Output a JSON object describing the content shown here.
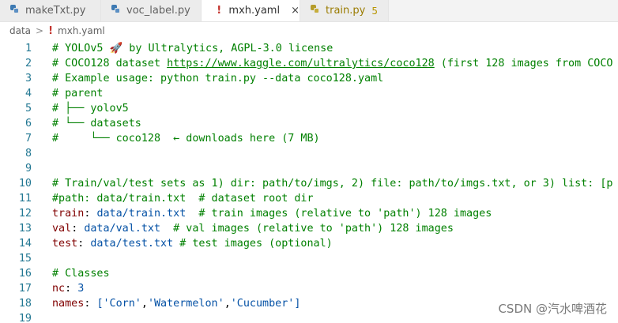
{
  "tabs": [
    {
      "label": "makeTxt.py",
      "icon": "python-file-icon"
    },
    {
      "label": "voc_label.py",
      "icon": "python-file-icon"
    },
    {
      "label": "mxh.yaml",
      "icon": "yaml-file-icon",
      "close": "×"
    },
    {
      "label": "train.py",
      "icon": "python-file-icon",
      "problems": "5"
    }
  ],
  "breadcrumb": {
    "folder": "data",
    "separator": ">",
    "file": "mxh.yaml",
    "yaml_glyph": "!"
  },
  "lines": [
    {
      "n": "1",
      "parts": [
        {
          "t": "# YOLOv5 🚀 by Ultralytics, AGPL-3.0 license",
          "s": "c"
        }
      ]
    },
    {
      "n": "2",
      "parts": [
        {
          "t": "# COCO128 dataset ",
          "s": "c"
        },
        {
          "t": "https://www.kaggle.com/ultralytics/coco128",
          "s": "c u"
        },
        {
          "t": " (first 128 images from COCO",
          "s": "c"
        }
      ]
    },
    {
      "n": "3",
      "parts": [
        {
          "t": "# Example usage: python train.py --data coco128.yaml",
          "s": "c"
        }
      ]
    },
    {
      "n": "4",
      "parts": [
        {
          "t": "# parent",
          "s": "c"
        }
      ]
    },
    {
      "n": "5",
      "parts": [
        {
          "t": "# ├── yolov5",
          "s": "c"
        }
      ]
    },
    {
      "n": "6",
      "parts": [
        {
          "t": "# └── datasets",
          "s": "c"
        }
      ]
    },
    {
      "n": "7",
      "parts": [
        {
          "t": "#     └── coco128  ← downloads here (7 MB)",
          "s": "c"
        }
      ]
    },
    {
      "n": "8",
      "parts": []
    },
    {
      "n": "9",
      "parts": []
    },
    {
      "n": "10",
      "parts": [
        {
          "t": "# Train/val/test sets as 1) dir: path/to/imgs, 2) file: path/to/imgs.txt, or 3) list: [p",
          "s": "c"
        }
      ]
    },
    {
      "n": "11",
      "parts": [
        {
          "t": "#path: data/train.txt  # dataset root dir",
          "s": "c"
        }
      ]
    },
    {
      "n": "12",
      "parts": [
        {
          "t": "train",
          "s": "k"
        },
        {
          "t": ": ",
          "s": "p"
        },
        {
          "t": "data/train.txt",
          "s": "v"
        },
        {
          "t": "  # train images (relative to 'path') 128 images",
          "s": "c"
        }
      ]
    },
    {
      "n": "13",
      "parts": [
        {
          "t": "val",
          "s": "k"
        },
        {
          "t": ": ",
          "s": "p"
        },
        {
          "t": "data/val.txt",
          "s": "v"
        },
        {
          "t": "  # val images (relative to 'path') 128 images",
          "s": "c"
        }
      ]
    },
    {
      "n": "14",
      "parts": [
        {
          "t": "test",
          "s": "k"
        },
        {
          "t": ": ",
          "s": "p"
        },
        {
          "t": "data/test.txt",
          "s": "v"
        },
        {
          "t": " # test images (optional)",
          "s": "c"
        }
      ]
    },
    {
      "n": "15",
      "parts": []
    },
    {
      "n": "16",
      "parts": [
        {
          "t": "# Classes",
          "s": "c"
        }
      ]
    },
    {
      "n": "17",
      "parts": [
        {
          "t": "nc",
          "s": "k"
        },
        {
          "t": ": ",
          "s": "p"
        },
        {
          "t": "3",
          "s": "v"
        }
      ]
    },
    {
      "n": "18",
      "parts": [
        {
          "t": "names",
          "s": "k"
        },
        {
          "t": ": ",
          "s": "p"
        },
        {
          "t": "[",
          "s": "v"
        },
        {
          "t": "'Corn'",
          "s": "v"
        },
        {
          "t": ",",
          "s": "p"
        },
        {
          "t": "'Watermelon'",
          "s": "v"
        },
        {
          "t": ",",
          "s": "p"
        },
        {
          "t": "'Cucumber'",
          "s": "v"
        },
        {
          "t": "]",
          "s": "v"
        }
      ]
    },
    {
      "n": "19",
      "parts": []
    }
  ],
  "watermark": "CSDN @汽水啤酒花",
  "colors": {
    "comment": "#008000",
    "key": "#800000",
    "value": "#0451a5",
    "line_number": "#237893"
  }
}
